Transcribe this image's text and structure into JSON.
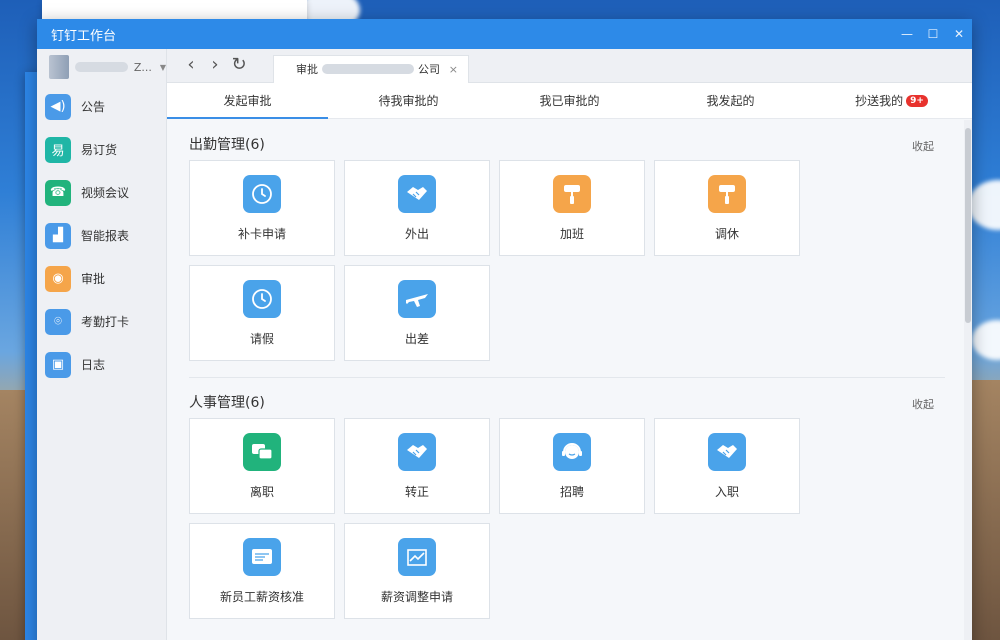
{
  "window": {
    "title": "钉钉工作台",
    "controls": [
      "—",
      "☐",
      "✕"
    ]
  },
  "user": {
    "trail": "Z...",
    "caret": "▼"
  },
  "sidebar": {
    "items": [
      {
        "label": "公告",
        "icon": "megaphone-icon",
        "color": "#4a9ae8",
        "glyph": "◀)"
      },
      {
        "label": "易订货",
        "icon": "order-icon",
        "color": "#1fb6a6",
        "glyph": "易"
      },
      {
        "label": "视频会议",
        "icon": "phone-icon",
        "color": "#21b37c",
        "glyph": "☎"
      },
      {
        "label": "智能报表",
        "icon": "report-icon",
        "color": "#4a9ae8",
        "glyph": "▟"
      },
      {
        "label": "审批",
        "icon": "approval-person-icon",
        "color": "#f5a54a",
        "glyph": "◉"
      },
      {
        "label": "考勤打卡",
        "icon": "location-icon",
        "color": "#4a9ae8",
        "glyph": "⌾"
      },
      {
        "label": "日志",
        "icon": "log-icon",
        "color": "#4a9ae8",
        "glyph": "▣"
      }
    ]
  },
  "nav": {
    "back": "‹",
    "forward": "›",
    "refresh": "↻",
    "tab_prefix": "审批",
    "tab_suffix": "公司",
    "tab_close": "×"
  },
  "tabs": [
    {
      "label": "发起审批",
      "active": true
    },
    {
      "label": "待我审批的"
    },
    {
      "label": "我已审批的"
    },
    {
      "label": "我发起的"
    },
    {
      "label": "抄送我的",
      "badge": "9+"
    }
  ],
  "sections": [
    {
      "title": "出勤管理(6)",
      "collapse": "收起",
      "items": [
        {
          "label": "补卡申请",
          "icon": "clock-icon",
          "color": "#4aa3ea"
        },
        {
          "label": "外出",
          "icon": "handshake-icon",
          "color": "#4aa3ea"
        },
        {
          "label": "加班",
          "icon": "paint-roller-icon",
          "color": "#f5a54a"
        },
        {
          "label": "调休",
          "icon": "paint-roller-icon",
          "color": "#f5a54a"
        },
        {
          "label": "请假",
          "icon": "clock-icon",
          "color": "#4aa3ea"
        },
        {
          "label": "出差",
          "icon": "airplane-icon",
          "color": "#4aa3ea"
        }
      ]
    },
    {
      "title": "人事管理(6)",
      "collapse": "收起",
      "items": [
        {
          "label": "离职",
          "icon": "chat-icon",
          "color": "#21b37c"
        },
        {
          "label": "转正",
          "icon": "handshake-icon",
          "color": "#4aa3ea"
        },
        {
          "label": "招聘",
          "icon": "headset-person-icon",
          "color": "#4aa3ea"
        },
        {
          "label": "入职",
          "icon": "handshake-icon",
          "color": "#4aa3ea"
        },
        {
          "label": "新员工薪资核准",
          "icon": "card-icon",
          "color": "#4aa3ea"
        },
        {
          "label": "薪资调整申请",
          "icon": "chart-up-icon",
          "color": "#4aa3ea"
        }
      ]
    }
  ]
}
